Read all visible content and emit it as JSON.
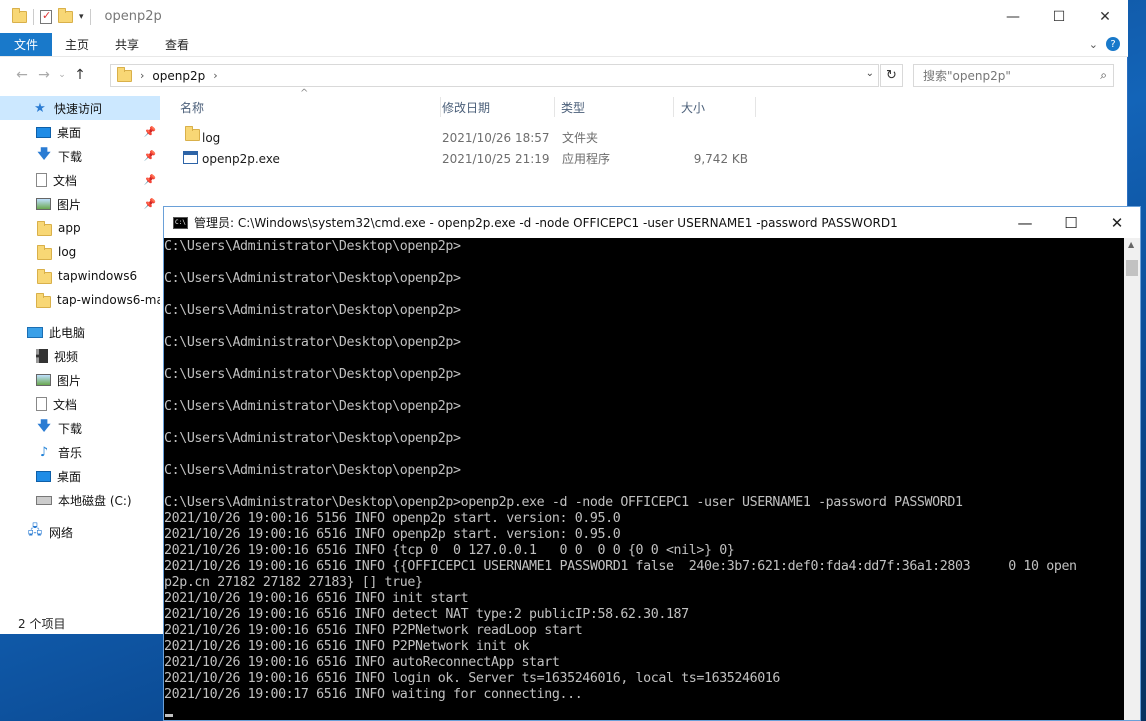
{
  "explorer": {
    "title": "openp2p",
    "ribbon_tabs": [
      "文件",
      "主页",
      "共享",
      "查看"
    ],
    "address_crumb": "openp2p",
    "search_placeholder": "搜索\"openp2p\"",
    "columns": {
      "name": "名称",
      "date": "修改日期",
      "type": "类型",
      "size": "大小"
    },
    "files": [
      {
        "name": "log",
        "date": "2021/10/26 18:57",
        "type": "文件夹",
        "size": "",
        "icon": "folder-icon"
      },
      {
        "name": "openp2p.exe",
        "date": "2021/10/25 21:19",
        "type": "应用程序",
        "size": "9,742 KB",
        "icon": "exe-icon"
      }
    ],
    "sidebar": {
      "quick_access": "快速访问",
      "quick_items": [
        "桌面",
        "下载",
        "文档",
        "图片",
        "app",
        "log",
        "tapwindows6",
        "tap-windows6-ma"
      ],
      "this_pc": "此电脑",
      "pc_items": [
        "视频",
        "图片",
        "文档",
        "下载",
        "音乐",
        "桌面",
        "本地磁盘 (C:)"
      ],
      "network": "网络"
    },
    "status_text": "2 个项目"
  },
  "cmd": {
    "title": "管理员: C:\\Windows\\system32\\cmd.exe - openp2p.exe  -d -node OFFICEPC1 -user USERNAME1 -password PASSWORD1",
    "lines": [
      "C:\\Users\\Administrator\\Desktop\\openp2p>",
      "",
      "C:\\Users\\Administrator\\Desktop\\openp2p>",
      "",
      "C:\\Users\\Administrator\\Desktop\\openp2p>",
      "",
      "C:\\Users\\Administrator\\Desktop\\openp2p>",
      "",
      "C:\\Users\\Administrator\\Desktop\\openp2p>",
      "",
      "C:\\Users\\Administrator\\Desktop\\openp2p>",
      "",
      "C:\\Users\\Administrator\\Desktop\\openp2p>",
      "",
      "C:\\Users\\Administrator\\Desktop\\openp2p>",
      "",
      "C:\\Users\\Administrator\\Desktop\\openp2p>openp2p.exe -d -node OFFICEPC1 -user USERNAME1 -password PASSWORD1",
      "2021/10/26 19:00:16 5156 INFO openp2p start. version: 0.95.0",
      "2021/10/26 19:00:16 6516 INFO openp2p start. version: 0.95.0",
      "2021/10/26 19:00:16 6516 INFO {tcp 0  0 127.0.0.1   0 0  0 0 {0 0 <nil>} 0}",
      "2021/10/26 19:00:16 6516 INFO {{OFFICEPC1 USERNAME1 PASSWORD1 false  240e:3b7:621:def0:fda4:dd7f:36a1:2803     0 10 open",
      "p2p.cn 27182 27182 27183} [] true}",
      "2021/10/26 19:00:16 6516 INFO init start",
      "2021/10/26 19:00:16 6516 INFO detect NAT type:2 publicIP:58.62.30.187",
      "2021/10/26 19:00:16 6516 INFO P2PNetwork readLoop start",
      "2021/10/26 19:00:16 6516 INFO P2PNetwork init ok",
      "2021/10/26 19:00:16 6516 INFO autoReconnectApp start",
      "2021/10/26 19:00:16 6516 INFO login ok. Server ts=1635246016, local ts=1635246016",
      "2021/10/26 19:00:17 6516 INFO waiting for connecting..."
    ]
  }
}
